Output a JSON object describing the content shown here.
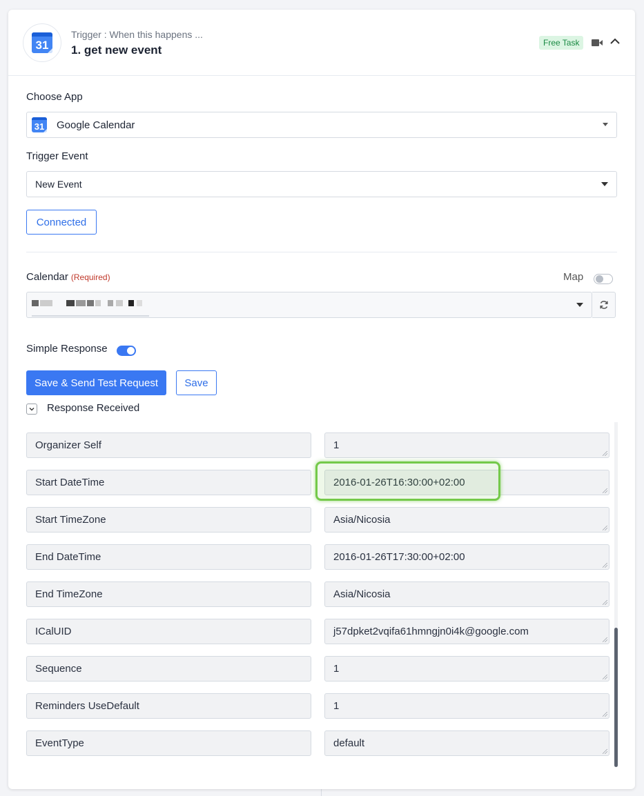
{
  "header": {
    "subtitle": "Trigger : When this happens ...",
    "title": "1. get new event",
    "badge": "Free Task",
    "logo_text": "31"
  },
  "choose_app": {
    "label": "Choose App",
    "value": "Google Calendar",
    "logo_text": "31"
  },
  "trigger_event": {
    "label": "Trigger Event",
    "value": "New Event"
  },
  "connected_label": "Connected",
  "calendar": {
    "label": "Calendar",
    "required": "(Required)",
    "map_label": "Map"
  },
  "simple_response": {
    "label": "Simple Response",
    "enabled": true
  },
  "buttons": {
    "save_send": "Save & Send Test Request",
    "save": "Save"
  },
  "response_received": "Response Received",
  "fields": [
    {
      "key": "Organizer Self",
      "value": "1"
    },
    {
      "key": "Start DateTime",
      "value": "2016-01-26T16:30:00+02:00"
    },
    {
      "key": "Start TimeZone",
      "value": "Asia/Nicosia"
    },
    {
      "key": "End DateTime",
      "value": "2016-01-26T17:30:00+02:00"
    },
    {
      "key": "End TimeZone",
      "value": "Asia/Nicosia"
    },
    {
      "key": "ICalUID",
      "value": "j57dpket2vqifa61hmngjn0i4k@google.com"
    },
    {
      "key": "Sequence",
      "value": "1"
    },
    {
      "key": "Reminders UseDefault",
      "value": "1"
    },
    {
      "key": "EventType",
      "value": "default"
    }
  ],
  "colors": {
    "accent": "#3a78f2",
    "badge_bg": "#dcf5e3",
    "badge_text": "#1a8a43",
    "highlight": "#74c94a"
  }
}
